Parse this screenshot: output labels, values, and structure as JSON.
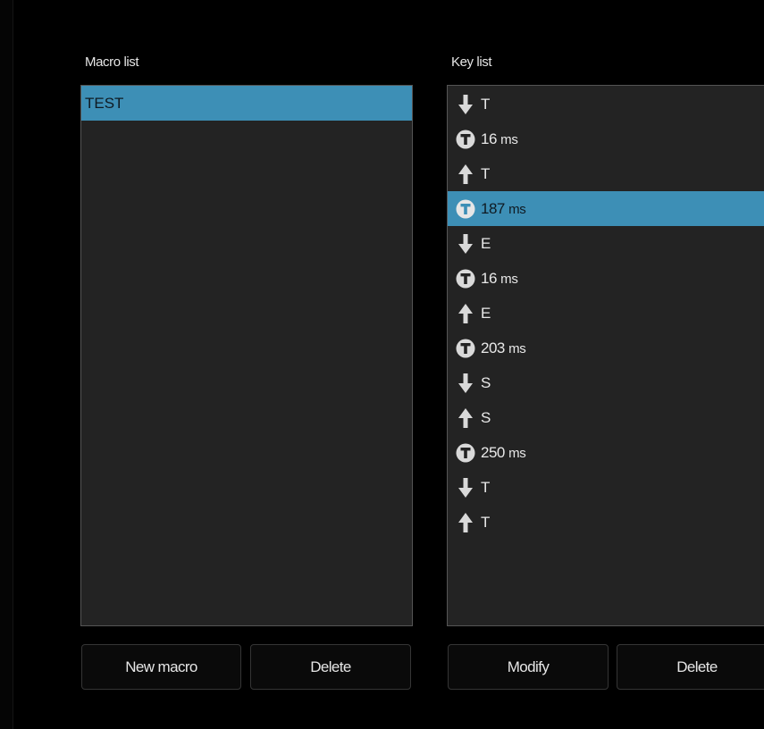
{
  "macro_panel": {
    "label": "Macro list",
    "items": [
      {
        "name": "TEST",
        "selected": true
      }
    ],
    "buttons": {
      "new_macro": "New macro",
      "delete": "Delete"
    }
  },
  "key_panel": {
    "label": "Key list",
    "items": [
      {
        "type": "key-down",
        "icon": "arrow-down-icon",
        "value": "T",
        "unit": "",
        "selected": false
      },
      {
        "type": "delay",
        "icon": "timer-icon",
        "value": "16",
        "unit": "ms",
        "selected": false
      },
      {
        "type": "key-up",
        "icon": "arrow-up-icon",
        "value": "T",
        "unit": "",
        "selected": false
      },
      {
        "type": "delay",
        "icon": "timer-icon",
        "value": "187",
        "unit": "ms",
        "selected": true
      },
      {
        "type": "key-down",
        "icon": "arrow-down-icon",
        "value": "E",
        "unit": "",
        "selected": false
      },
      {
        "type": "delay",
        "icon": "timer-icon",
        "value": "16",
        "unit": "ms",
        "selected": false
      },
      {
        "type": "key-up",
        "icon": "arrow-up-icon",
        "value": "E",
        "unit": "",
        "selected": false
      },
      {
        "type": "delay",
        "icon": "timer-icon",
        "value": "203",
        "unit": "ms",
        "selected": false
      },
      {
        "type": "key-down",
        "icon": "arrow-down-icon",
        "value": "S",
        "unit": "",
        "selected": false
      },
      {
        "type": "key-up",
        "icon": "arrow-up-icon",
        "value": "S",
        "unit": "",
        "selected": false
      },
      {
        "type": "delay",
        "icon": "timer-icon",
        "value": "250",
        "unit": "ms",
        "selected": false
      },
      {
        "type": "key-down",
        "icon": "arrow-down-icon",
        "value": "T",
        "unit": "",
        "selected": false
      },
      {
        "type": "key-up",
        "icon": "arrow-up-icon",
        "value": "T",
        "unit": "",
        "selected": false
      }
    ],
    "buttons": {
      "modify": "Modify",
      "delete": "Delete"
    }
  },
  "colors": {
    "background": "#000000",
    "list_background": "#232323",
    "list_border": "#555555",
    "selection": "#3d8fb6",
    "text": "#e8e8e8",
    "icon": "#d9d9d9"
  }
}
